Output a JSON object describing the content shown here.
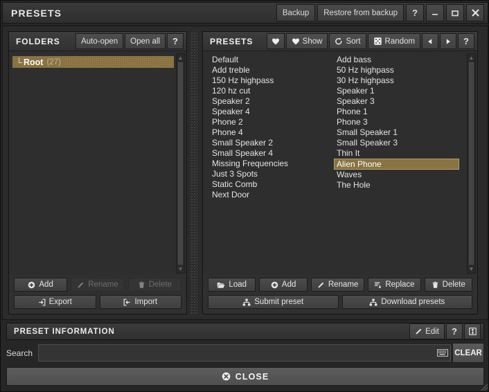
{
  "window": {
    "title": "PRESETS",
    "backup_label": "Backup",
    "restore_label": "Restore from backup",
    "help_label": "?",
    "minimize_label": "–",
    "maximize_label": "□",
    "close_label": "✕"
  },
  "folders": {
    "title": "FOLDERS",
    "auto_open_label": "Auto-open",
    "open_all_label": "Open all",
    "help_label": "?",
    "tree": [
      {
        "elbow": "└",
        "label": "Root",
        "count": "(27)",
        "selected": true
      }
    ],
    "buttons": {
      "add": "Add",
      "rename": "Rename",
      "delete": "Delete",
      "export": "Export",
      "import": "Import"
    }
  },
  "presets": {
    "title": "PRESETS",
    "favorite_label": "",
    "show_label": "Show",
    "sort_label": "Sort",
    "random_label": "Random",
    "prev_label": "◀",
    "next_label": "▶",
    "help_label": "?",
    "column_left": [
      "Default",
      "Add treble",
      "150 Hz highpass",
      "120 hz cut",
      "Speaker 2",
      "Speaker 4",
      "Phone 2",
      "Phone 4",
      "Small Speaker 2",
      "Small Speaker 4",
      "Missing Frequencies",
      "Just 3 Spots",
      "Static Comb",
      "Next Door"
    ],
    "column_right": [
      "Add bass",
      "50 Hz highpass",
      "30 Hz highpass",
      "Speaker 1",
      "Speaker 3",
      "Phone 1",
      "Phone 3",
      "Small Speaker 1",
      "Small Speaker 3",
      "Thin It",
      "Alien Phone",
      "Waves",
      "The Hole"
    ],
    "selected_preset": "Alien Phone",
    "buttons": {
      "load": "Load",
      "add": "Add",
      "rename": "Rename",
      "replace": "Replace",
      "delete": "Delete",
      "submit": "Submit preset",
      "download": "Download presets"
    }
  },
  "preset_information": {
    "title": "PRESET INFORMATION",
    "edit_label": "Edit",
    "help_label": "?",
    "expand_label": "⬍"
  },
  "search": {
    "label": "Search",
    "value": "",
    "placeholder": "",
    "clear_label": "CLEAR"
  },
  "footer": {
    "close_label": "CLOSE"
  },
  "colors": {
    "highlight": "#8a7342",
    "panel_bg": "#2e2e2e",
    "window_bg": "#262626",
    "text": "#e4e4e4"
  }
}
